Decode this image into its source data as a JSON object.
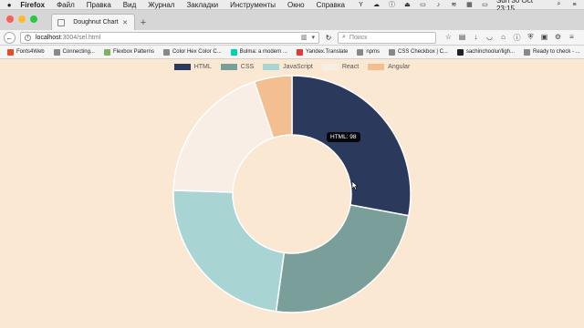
{
  "menubar": {
    "app": "Firefox",
    "items": [
      "Файл",
      "Правка",
      "Вид",
      "Журнал",
      "Закладки",
      "Инструменты",
      "Окно",
      "Справка"
    ],
    "clock": "Sun 30 Oct  23:15"
  },
  "tab": {
    "title": "Doughnut Chart"
  },
  "nav": {
    "url_host": "localhost",
    "url_path": ":3004/sel.html",
    "search_placeholder": "Поиск"
  },
  "bookmarks": [
    {
      "label": "Fonts4Web",
      "color": "#e44d26"
    },
    {
      "label": "Connecting...",
      "color": "#888888"
    },
    {
      "label": "Flexbox Patterns",
      "color": "#7fb069"
    },
    {
      "label": "Color Hex Color C...",
      "color": "#888888"
    },
    {
      "label": "Bulma: a modern ...",
      "color": "#00d1b2"
    },
    {
      "label": "Yandex.Translate",
      "color": "#e53935"
    },
    {
      "label": "npms",
      "color": "#888888"
    },
    {
      "label": "CSS Checkbox | C...",
      "color": "#888888"
    },
    {
      "label": "sachinchoolur/ligh...",
      "color": "#222222"
    },
    {
      "label": "Ready to check - ...",
      "color": "#888888"
    }
  ],
  "tooltip": "HTML: 98",
  "chart_data": {
    "type": "doughnut",
    "categories": [
      "HTML",
      "CSS",
      "JavaScript",
      "React",
      "Angular"
    ],
    "values": [
      98,
      85,
      82,
      68,
      18
    ],
    "colors": [
      "#2b3a5c",
      "#7a9e99",
      "#a8d4d4",
      "#f8eee5",
      "#f4bf90"
    ],
    "legend_position": "top",
    "cutout_percent": 50
  }
}
